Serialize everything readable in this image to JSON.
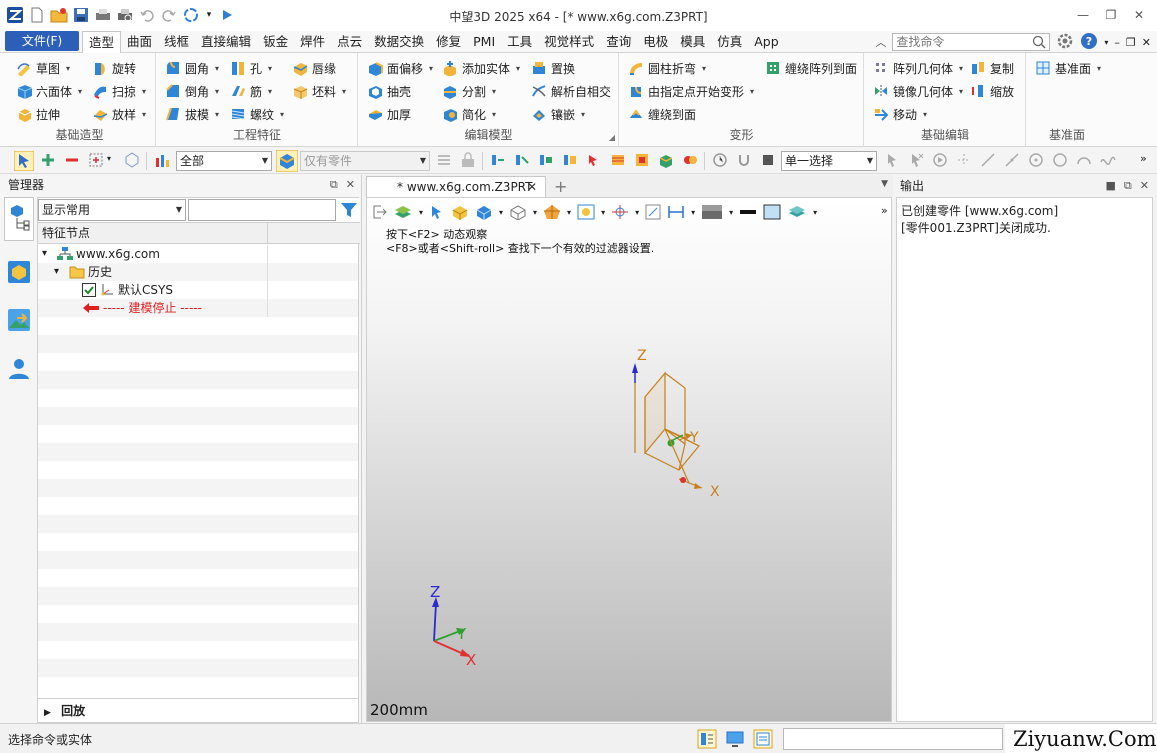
{
  "title_bar": {
    "title": "中望3D 2025 x64 - [* www.x6g.com.Z3PRT]",
    "quick_access": [
      "app-logo-icon",
      "new-file-icon",
      "open-file-icon",
      "save-icon",
      "print-icon",
      "print-preview-icon",
      "undo-icon",
      "redo-icon",
      "refresh-icon",
      "customize-icon",
      "play-icon"
    ]
  },
  "menu": {
    "file_label": "文件(F)",
    "tabs": [
      "造型",
      "曲面",
      "线框",
      "直接编辑",
      "钣金",
      "焊件",
      "点云",
      "数据交换",
      "修复",
      "PMI",
      "工具",
      "视觉样式",
      "查询",
      "电极",
      "模具",
      "仿真",
      "App"
    ],
    "active_tab": "造型",
    "search_placeholder": "查找命令"
  },
  "ribbon": {
    "groups": [
      {
        "title": "基础造型",
        "items": [
          {
            "label": "草图",
            "icon": "sketch-icon",
            "dropdown": true
          },
          {
            "label": "旋转",
            "icon": "revolve-icon",
            "dropdown": false
          },
          {
            "label": "六面体",
            "icon": "block-icon",
            "dropdown": true
          },
          {
            "label": "扫掠",
            "icon": "sweep-icon",
            "dropdown": true
          },
          {
            "label": "拉伸",
            "icon": "extrude-icon",
            "dropdown": false
          },
          {
            "label": "放样",
            "icon": "loft-icon",
            "dropdown": true
          }
        ]
      },
      {
        "title": "工程特征",
        "items": [
          {
            "label": "圆角",
            "icon": "fillet-icon",
            "dropdown": true
          },
          {
            "label": "孔",
            "icon": "hole-icon",
            "dropdown": true
          },
          {
            "label": "唇缘",
            "icon": "lip-icon",
            "dropdown": false
          },
          {
            "label": "倒角",
            "icon": "chamfer-icon",
            "dropdown": true
          },
          {
            "label": "筋",
            "icon": "rib-icon",
            "dropdown": true
          },
          {
            "label": "坯料",
            "icon": "stock-icon",
            "dropdown": true
          },
          {
            "label": "拔模",
            "icon": "draft-icon",
            "dropdown": true
          },
          {
            "label": "螺纹",
            "icon": "thread-icon",
            "dropdown": true
          }
        ]
      },
      {
        "title": "编辑模型",
        "items": [
          {
            "label": "面偏移",
            "icon": "face-offset-icon",
            "dropdown": true
          },
          {
            "label": "添加实体",
            "icon": "add-solid-icon",
            "dropdown": true
          },
          {
            "label": "置换",
            "icon": "replace-icon",
            "dropdown": false
          },
          {
            "label": "抽壳",
            "icon": "shell-icon",
            "dropdown": false
          },
          {
            "label": "分割",
            "icon": "split-icon",
            "dropdown": true
          },
          {
            "label": "解析自相交",
            "icon": "resolve-icon",
            "dropdown": false
          },
          {
            "label": "加厚",
            "icon": "thicken-icon",
            "dropdown": false
          },
          {
            "label": "简化",
            "icon": "simplify-icon",
            "dropdown": true
          },
          {
            "label": "镶嵌",
            "icon": "emboss-icon",
            "dropdown": true
          }
        ]
      },
      {
        "title": "变形",
        "items": [
          {
            "label": "圆柱折弯",
            "icon": "cylinder-bend-icon",
            "dropdown": true
          },
          {
            "label": "缠绕阵列到面",
            "icon": "wrap-pattern-icon",
            "dropdown": false
          },
          {
            "label": "由指定点开始变形",
            "icon": "point-deform-icon",
            "dropdown": true
          },
          {
            "label": "缠绕到面",
            "icon": "wrap-face-icon",
            "dropdown": false
          }
        ]
      },
      {
        "title": "基础编辑",
        "items": [
          {
            "label": "阵列几何体",
            "icon": "pattern-icon",
            "dropdown": true
          },
          {
            "label": "复制",
            "icon": "copy-icon",
            "dropdown": false
          },
          {
            "label": "镜像几何体",
            "icon": "mirror-icon",
            "dropdown": true
          },
          {
            "label": "缩放",
            "icon": "scale-icon",
            "dropdown": false
          },
          {
            "label": "移动",
            "icon": "move-icon",
            "dropdown": true
          }
        ]
      },
      {
        "title": "基准面",
        "items": [
          {
            "label": "基准面",
            "icon": "datum-plane-icon",
            "dropdown": true
          }
        ]
      }
    ]
  },
  "toolbar2": {
    "filter_value": "全部",
    "filter_part_value": "仅有零件",
    "select_mode_value": "单一选择"
  },
  "manager": {
    "title": "管理器",
    "display_filter": "显示常用",
    "column_header": "特征节点",
    "tree": [
      {
        "label": "www.x6g.com",
        "icon": "assembly-icon",
        "level": 0,
        "expander": "▾"
      },
      {
        "label": "历史",
        "icon": "folder-icon",
        "level": 1,
        "expander": "▾"
      },
      {
        "label": "默认CSYS",
        "icon": "csys-icon",
        "level": 2,
        "expander": "",
        "checked": true
      },
      {
        "label": "----- 建模停止 -----",
        "icon": "stop-arrow-icon",
        "level": 2,
        "expander": "",
        "stop": true
      }
    ],
    "rollback_label": "回放"
  },
  "document": {
    "tab_label": "* www.x6g.com.Z3PRT",
    "hint_line1": "按下<F2> 动态观察",
    "hint_line2": "<F8>或者<Shift-roll> 查找下一个有效的过滤器设置.",
    "scale_label": "200mm",
    "axis_labels": {
      "z": "Z",
      "y": "Y",
      "x": "X"
    }
  },
  "output": {
    "title": "输出",
    "lines": [
      "已创建零件 [www.x6g.com]",
      "[零件001.Z3PRT]关闭成功."
    ]
  },
  "status": {
    "text": "选择命令或实体",
    "watermark": "Ziyuanw.Com"
  },
  "colors": {
    "accent": "#2c5fb7",
    "model_orange": "#c8801c",
    "stop_red": "#e02020"
  }
}
